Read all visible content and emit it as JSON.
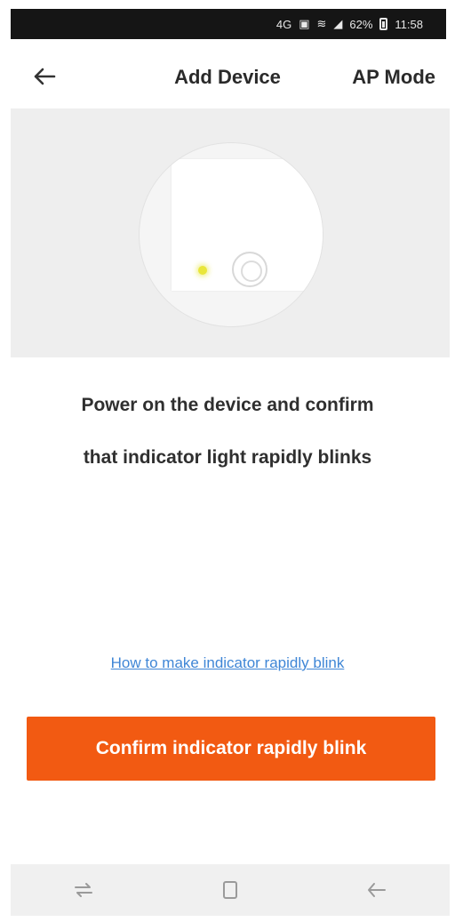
{
  "status_bar": {
    "network_label": "4G",
    "battery_percent": "62%",
    "time": "11:58"
  },
  "header": {
    "back_icon": "arrow-left-icon",
    "title": "Add Device",
    "mode_label": "AP Mode"
  },
  "illustration": {
    "indicator_color": "#e9e63a"
  },
  "instruction": {
    "line1": "Power on the device and confirm",
    "line2": "that indicator light rapidly blinks"
  },
  "help_link": "How to make indicator rapidly blink",
  "confirm_button": {
    "label": "Confirm indicator rapidly blink",
    "color": "#f25a12"
  },
  "nav_bar": {
    "icons": [
      "recent-apps-icon",
      "home-icon",
      "back-icon"
    ]
  }
}
